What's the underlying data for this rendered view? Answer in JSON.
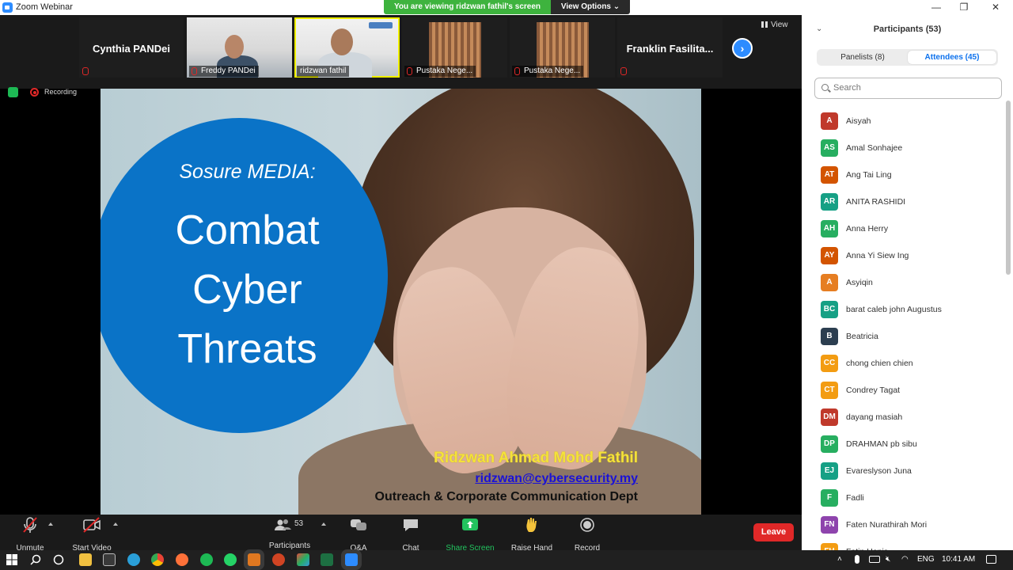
{
  "window": {
    "title": "Zoom Webinar",
    "banner": "You are viewing ridzwan fathil's screen",
    "view_options": "View Options"
  },
  "gallery": {
    "view_label": "View",
    "tiles": [
      {
        "name": "Cynthia PANDei",
        "label": ""
      },
      {
        "name": "",
        "label": "Freddy PANDei"
      },
      {
        "name": "",
        "label": "ridzwan fathil"
      },
      {
        "name": "",
        "label": "Pustaka Nege..."
      },
      {
        "name": "",
        "label": "Pustaka Nege..."
      },
      {
        "name": "Franklin  Fasilita...",
        "label": ""
      }
    ]
  },
  "status": {
    "recording": "Recording"
  },
  "slide": {
    "subtitle": "Sosure MEDIA:",
    "line1": "Combat",
    "line2": "Cyber",
    "line3": "Threats",
    "presenter": "Ridzwan Ahmad Mohd Fathil",
    "email": "ridzwan@cybersecurity.my",
    "department": "Outreach & Corporate Communication Dept"
  },
  "toolbar": {
    "unmute": "Unmute",
    "start_video": "Start Video",
    "participants": "Participants",
    "participants_count": "53",
    "qa": "Q&A",
    "chat": "Chat",
    "share_screen": "Share Screen",
    "raise_hand": "Raise Hand",
    "record": "Record",
    "leave": "Leave"
  },
  "panel": {
    "title": "Participants (53)",
    "tab_panelists": "Panelists (8)",
    "tab_attendees": "Attendees (45)",
    "search_placeholder": "Search",
    "attendees": [
      {
        "initials": "A",
        "name": "Aisyah",
        "color": "#c0392b"
      },
      {
        "initials": "AS",
        "name": "Amal Sonhajee",
        "color": "#27ae60"
      },
      {
        "initials": "AT",
        "name": "Ang Tai Ling",
        "color": "#d35400"
      },
      {
        "initials": "AR",
        "name": "ANITA RASHIDI",
        "color": "#16a085"
      },
      {
        "initials": "AH",
        "name": "Anna Herry",
        "color": "#27ae60"
      },
      {
        "initials": "AY",
        "name": "Anna Yi Siew Ing",
        "color": "#d35400"
      },
      {
        "initials": "A",
        "name": "Asyiqin",
        "color": "#e67e22"
      },
      {
        "initials": "BC",
        "name": "barat caleb john Augustus",
        "color": "#16a085"
      },
      {
        "initials": "B",
        "name": "Beatricia",
        "color": "#2c3e50"
      },
      {
        "initials": "CC",
        "name": "chong chien chien",
        "color": "#f39c12"
      },
      {
        "initials": "CT",
        "name": "Condrey Tagat",
        "color": "#f39c12"
      },
      {
        "initials": "DM",
        "name": "dayang masiah",
        "color": "#c0392b"
      },
      {
        "initials": "DP",
        "name": "DRAHMAN pb sibu",
        "color": "#27ae60"
      },
      {
        "initials": "EJ",
        "name": "Evareslyson Juna",
        "color": "#16a085"
      },
      {
        "initials": "F",
        "name": "Fadli",
        "color": "#27ae60"
      },
      {
        "initials": "FN",
        "name": "Faten Nurathirah Mori",
        "color": "#8e44ad"
      },
      {
        "initials": "FH",
        "name": "Fatin Hanis",
        "color": "#f39c12"
      }
    ]
  },
  "taskbar": {
    "language": "ENG",
    "time": "10:41 AM"
  },
  "colors": {
    "zoom_blue": "#2d8cff",
    "leave_red": "#e02828",
    "banner_green": "#3eb33e",
    "share_green": "#22c35e",
    "slide_circle": "#0a73c7"
  }
}
